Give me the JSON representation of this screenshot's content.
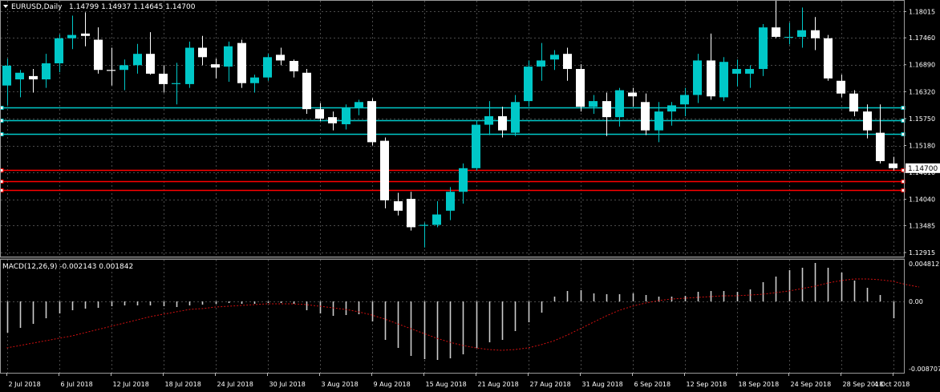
{
  "header": {
    "symbol": "EURUSD,Daily",
    "ohlc": "1.14799 1.14937 1.14645 1.14700"
  },
  "macd_header": {
    "label": "MACD(12,26,9) -0.002143 0.001842"
  },
  "colors": {
    "background": "#000000",
    "bull_candle": "#00c8c8",
    "bear_candle": "#ffffff",
    "grid": "#4a4a4a",
    "support_lines": "#00c8c8",
    "resistance_lines": "#ff0000",
    "macd_signal": "#d01010",
    "macd_histogram": "#cccccc",
    "current_price_box": "#ffffff"
  },
  "chart_data": [
    {
      "type": "candlestick",
      "symbol": "EURUSD",
      "timeframe": "Daily",
      "ylim": [
        1.1283,
        1.1826
      ],
      "price_ticks": [
        "1.18015",
        "1.17460",
        "1.16890",
        "1.16320",
        "1.15750",
        "1.15180",
        "1.14610",
        "1.14040",
        "1.13485",
        "1.12915"
      ],
      "current_price": "1.14700",
      "date_labels": [
        "2 Jul 2018",
        "6 Jul 2018",
        "12 Jul 2018",
        "18 Jul 2018",
        "24 Jul 2018",
        "30 Jul 2018",
        "3 Aug 2018",
        "9 Aug 2018",
        "15 Aug 2018",
        "21 Aug 2018",
        "27 Aug 2018",
        "31 Aug 2018",
        "6 Sep 2018",
        "12 Sep 2018",
        "18 Sep 2018",
        "24 Sep 2018",
        "28 Sep 2018",
        "4 Oct 2018"
      ],
      "date_label_bars": [
        0,
        4,
        8,
        12,
        16,
        20,
        24,
        28,
        32,
        36,
        40,
        44,
        48,
        52,
        56,
        60,
        64,
        68
      ],
      "horizontal_lines": {
        "cyan": [
          1.1598,
          1.1572,
          1.1543
        ],
        "red": [
          1.1466,
          1.1442,
          1.1424
        ]
      },
      "candles": [
        {
          "o": 1.1645,
          "h": 1.1702,
          "l": 1.1603,
          "c": 1.1687
        },
        {
          "o": 1.1658,
          "h": 1.1678,
          "l": 1.162,
          "c": 1.1672
        },
        {
          "o": 1.1665,
          "h": 1.168,
          "l": 1.163,
          "c": 1.1658
        },
        {
          "o": 1.1658,
          "h": 1.1712,
          "l": 1.164,
          "c": 1.1692
        },
        {
          "o": 1.1692,
          "h": 1.1753,
          "l": 1.1673,
          "c": 1.1745
        },
        {
          "o": 1.1745,
          "h": 1.1793,
          "l": 1.1722,
          "c": 1.1752
        },
        {
          "o": 1.1755,
          "h": 1.18,
          "l": 1.1728,
          "c": 1.175
        },
        {
          "o": 1.1742,
          "h": 1.1768,
          "l": 1.167,
          "c": 1.1678
        },
        {
          "o": 1.1678,
          "h": 1.1725,
          "l": 1.1645,
          "c": 1.1676
        },
        {
          "o": 1.1678,
          "h": 1.17,
          "l": 1.1635,
          "c": 1.1688
        },
        {
          "o": 1.1688,
          "h": 1.1733,
          "l": 1.167,
          "c": 1.1712
        },
        {
          "o": 1.1712,
          "h": 1.1758,
          "l": 1.1668,
          "c": 1.167
        },
        {
          "o": 1.167,
          "h": 1.1688,
          "l": 1.163,
          "c": 1.1648
        },
        {
          "o": 1.1648,
          "h": 1.1693,
          "l": 1.1605,
          "c": 1.165
        },
        {
          "o": 1.1648,
          "h": 1.1738,
          "l": 1.164,
          "c": 1.1725
        },
        {
          "o": 1.1725,
          "h": 1.175,
          "l": 1.1688,
          "c": 1.1705
        },
        {
          "o": 1.169,
          "h": 1.1702,
          "l": 1.166,
          "c": 1.1683
        },
        {
          "o": 1.1685,
          "h": 1.1738,
          "l": 1.1653,
          "c": 1.1728
        },
        {
          "o": 1.1735,
          "h": 1.1742,
          "l": 1.164,
          "c": 1.165
        },
        {
          "o": 1.165,
          "h": 1.1668,
          "l": 1.163,
          "c": 1.1662
        },
        {
          "o": 1.1662,
          "h": 1.1712,
          "l": 1.1655,
          "c": 1.1705
        },
        {
          "o": 1.171,
          "h": 1.1725,
          "l": 1.1688,
          "c": 1.1698
        },
        {
          "o": 1.1697,
          "h": 1.17,
          "l": 1.1662,
          "c": 1.1675
        },
        {
          "o": 1.1672,
          "h": 1.168,
          "l": 1.1585,
          "c": 1.1595
        },
        {
          "o": 1.1595,
          "h": 1.1608,
          "l": 1.157,
          "c": 1.1575
        },
        {
          "o": 1.1578,
          "h": 1.159,
          "l": 1.155,
          "c": 1.1565
        },
        {
          "o": 1.1563,
          "h": 1.1605,
          "l": 1.1552,
          "c": 1.1598
        },
        {
          "o": 1.1598,
          "h": 1.1615,
          "l": 1.1582,
          "c": 1.161
        },
        {
          "o": 1.1612,
          "h": 1.1618,
          "l": 1.1518,
          "c": 1.1525
        },
        {
          "o": 1.1528,
          "h": 1.1535,
          "l": 1.1385,
          "c": 1.1402
        },
        {
          "o": 1.14,
          "h": 1.1418,
          "l": 1.137,
          "c": 1.138
        },
        {
          "o": 1.1405,
          "h": 1.142,
          "l": 1.1338,
          "c": 1.1345
        },
        {
          "o": 1.1348,
          "h": 1.1355,
          "l": 1.1302,
          "c": 1.135
        },
        {
          "o": 1.135,
          "h": 1.14,
          "l": 1.1345,
          "c": 1.1372
        },
        {
          "o": 1.138,
          "h": 1.143,
          "l": 1.136,
          "c": 1.142
        },
        {
          "o": 1.142,
          "h": 1.148,
          "l": 1.1395,
          "c": 1.147
        },
        {
          "o": 1.147,
          "h": 1.157,
          "l": 1.1465,
          "c": 1.1562
        },
        {
          "o": 1.1562,
          "h": 1.1612,
          "l": 1.154,
          "c": 1.158
        },
        {
          "o": 1.158,
          "h": 1.16,
          "l": 1.1535,
          "c": 1.155
        },
        {
          "o": 1.1545,
          "h": 1.1625,
          "l": 1.1538,
          "c": 1.161
        },
        {
          "o": 1.1612,
          "h": 1.1698,
          "l": 1.16,
          "c": 1.1685
        },
        {
          "o": 1.1685,
          "h": 1.1735,
          "l": 1.1655,
          "c": 1.1698
        },
        {
          "o": 1.17,
          "h": 1.172,
          "l": 1.1678,
          "c": 1.171
        },
        {
          "o": 1.1712,
          "h": 1.1725,
          "l": 1.1655,
          "c": 1.168
        },
        {
          "o": 1.168,
          "h": 1.169,
          "l": 1.159,
          "c": 1.16
        },
        {
          "o": 1.16,
          "h": 1.1625,
          "l": 1.1585,
          "c": 1.1612
        },
        {
          "o": 1.1612,
          "h": 1.163,
          "l": 1.1538,
          "c": 1.1578
        },
        {
          "o": 1.1578,
          "h": 1.164,
          "l": 1.1558,
          "c": 1.1635
        },
        {
          "o": 1.163,
          "h": 1.164,
          "l": 1.16,
          "c": 1.1622
        },
        {
          "o": 1.161,
          "h": 1.1628,
          "l": 1.154,
          "c": 1.155
        },
        {
          "o": 1.155,
          "h": 1.161,
          "l": 1.1525,
          "c": 1.159
        },
        {
          "o": 1.159,
          "h": 1.161,
          "l": 1.156,
          "c": 1.1603
        },
        {
          "o": 1.1605,
          "h": 1.164,
          "l": 1.158,
          "c": 1.1625
        },
        {
          "o": 1.1625,
          "h": 1.1712,
          "l": 1.1608,
          "c": 1.1698
        },
        {
          "o": 1.1698,
          "h": 1.1755,
          "l": 1.1615,
          "c": 1.1622
        },
        {
          "o": 1.162,
          "h": 1.1705,
          "l": 1.1612,
          "c": 1.1695
        },
        {
          "o": 1.167,
          "h": 1.17,
          "l": 1.1643,
          "c": 1.168
        },
        {
          "o": 1.167,
          "h": 1.1688,
          "l": 1.164,
          "c": 1.168
        },
        {
          "o": 1.168,
          "h": 1.1775,
          "l": 1.1665,
          "c": 1.1768
        },
        {
          "o": 1.1768,
          "h": 1.1825,
          "l": 1.1745,
          "c": 1.1748
        },
        {
          "o": 1.1748,
          "h": 1.1778,
          "l": 1.1732,
          "c": 1.1748
        },
        {
          "o": 1.1748,
          "h": 1.181,
          "l": 1.1725,
          "c": 1.1762
        },
        {
          "o": 1.1762,
          "h": 1.179,
          "l": 1.172,
          "c": 1.1745
        },
        {
          "o": 1.1745,
          "h": 1.1752,
          "l": 1.1655,
          "c": 1.166
        },
        {
          "o": 1.1655,
          "h": 1.1668,
          "l": 1.162,
          "c": 1.1628
        },
        {
          "o": 1.1628,
          "h": 1.1635,
          "l": 1.158,
          "c": 1.159
        },
        {
          "o": 1.159,
          "h": 1.1605,
          "l": 1.1533,
          "c": 1.155
        },
        {
          "o": 1.1545,
          "h": 1.1605,
          "l": 1.148,
          "c": 1.1485
        },
        {
          "o": 1.148,
          "h": 1.1494,
          "l": 1.1465,
          "c": 1.147
        }
      ]
    },
    {
      "type": "bar",
      "title": "MACD(12,26,9)",
      "macd": "-0.002143",
      "signal": "0.001842",
      "ylim": [
        -0.0089,
        0.0052
      ],
      "y_ticks": [
        "0.004812",
        "0.00",
        "-0.008707"
      ],
      "histogram": [
        -0.0039,
        -0.0033,
        -0.0028,
        -0.0021,
        -0.0015,
        -0.0011,
        -0.0009,
        -0.0008,
        -0.0006,
        -0.0005,
        -0.0005,
        -0.0005,
        -0.0006,
        -0.0007,
        -0.0005,
        -0.0004,
        -0.0003,
        -0.0002,
        -0.0003,
        -0.0003,
        -0.0002,
        -0.0002,
        -0.0003,
        -0.0011,
        -0.0015,
        -0.0018,
        -0.0017,
        -0.0016,
        -0.0025,
        -0.0048,
        -0.0058,
        -0.0068,
        -0.0072,
        -0.0073,
        -0.0071,
        -0.0066,
        -0.0058,
        -0.0051,
        -0.0048,
        -0.0037,
        -0.0026,
        -0.0014,
        0.0006,
        0.0013,
        0.0014,
        0.001,
        0.0009,
        0.0009,
        0.001,
        0.0008,
        0.0006,
        0.0006,
        0.0007,
        0.0012,
        0.0013,
        0.0013,
        0.0012,
        0.0015,
        0.0024,
        0.0031,
        0.0039,
        0.0042,
        0.0048,
        0.0042,
        0.0036,
        0.0026,
        0.0017,
        0.0008,
        -0.0021
      ],
      "signal_line": [
        -0.0058,
        -0.0055,
        -0.0052,
        -0.0049,
        -0.0046,
        -0.0043,
        -0.0039,
        -0.0035,
        -0.0031,
        -0.0027,
        -0.0023,
        -0.0019,
        -0.0016,
        -0.0013,
        -0.001,
        -0.0009,
        -0.0007,
        -0.0006,
        -0.0005,
        -0.0004,
        -0.0003,
        -0.0003,
        -0.0003,
        -0.0004,
        -0.0006,
        -0.0008,
        -0.001,
        -0.0013,
        -0.0017,
        -0.0022,
        -0.0028,
        -0.0034,
        -0.004,
        -0.0046,
        -0.0051,
        -0.0055,
        -0.0058,
        -0.006,
        -0.0061,
        -0.006,
        -0.0058,
        -0.0054,
        -0.0049,
        -0.0042,
        -0.0034,
        -0.0026,
        -0.0018,
        -0.0011,
        -0.0006,
        -0.0002,
        0.0001,
        0.0003,
        0.0004,
        0.0005,
        0.0006,
        0.0007,
        0.0007,
        0.0008,
        0.0009,
        0.0011,
        0.0013,
        0.0016,
        0.0019,
        0.0023,
        0.0026,
        0.0028,
        0.0028,
        0.0027,
        0.0025,
        0.0021,
        0.0018
      ]
    }
  ]
}
